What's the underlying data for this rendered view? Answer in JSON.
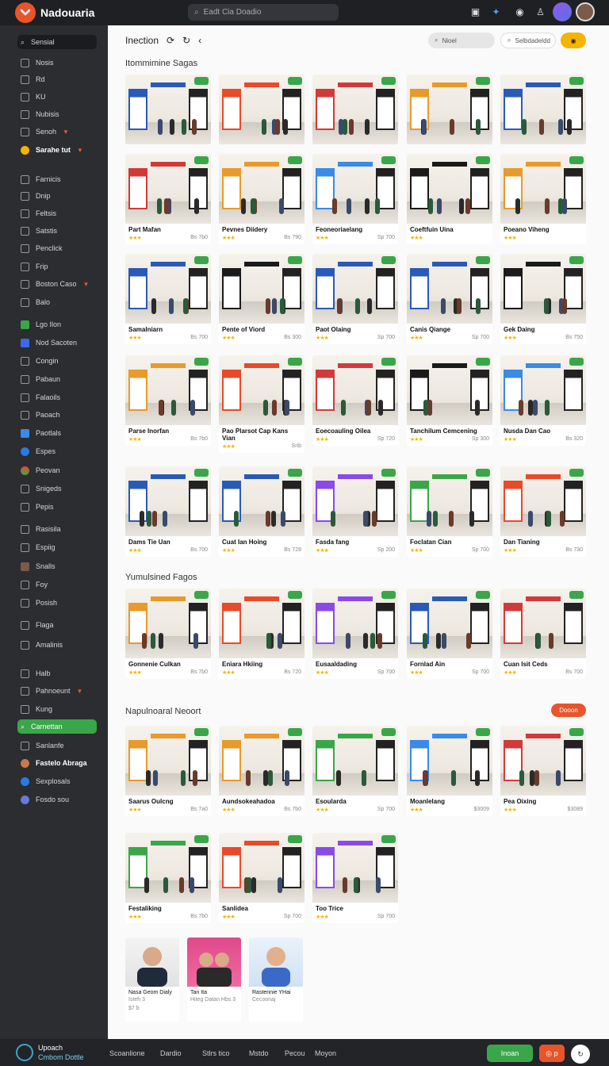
{
  "app": {
    "name": "Nadouaria",
    "search_placeholder": "Eadt Cia Doadio"
  },
  "sidebar": {
    "items": [
      {
        "label": "Sensial",
        "y": 0
      },
      {
        "label": "Nosis"
      },
      {
        "label": "Rd"
      },
      {
        "label": "KU"
      },
      {
        "label": "Nubisis"
      },
      {
        "label": "Senoh"
      },
      {
        "label": "Sarahe tut"
      },
      {
        "label": "Farnicis"
      },
      {
        "label": "Dnip"
      },
      {
        "label": "Feltsis"
      },
      {
        "label": "Satstis"
      },
      {
        "label": "Penclick"
      },
      {
        "label": "Frip"
      },
      {
        "label": "Boston Caso"
      },
      {
        "label": "Balo"
      },
      {
        "label": "Lgo Ilon"
      },
      {
        "label": "Nod Sacoten"
      },
      {
        "label": "Congin"
      },
      {
        "label": "Pabaun"
      },
      {
        "label": "Falaoils"
      },
      {
        "label": "Paoach"
      },
      {
        "label": "Paotlals"
      },
      {
        "label": "Espes"
      },
      {
        "label": "Peovan"
      },
      {
        "label": "Snigeds"
      },
      {
        "label": "Pepis"
      },
      {
        "label": "Rasisila"
      },
      {
        "label": "Espiig"
      },
      {
        "label": "Snalls"
      },
      {
        "label": "Foy"
      },
      {
        "label": "Posish"
      },
      {
        "label": "Flaga"
      },
      {
        "label": "Amalinis"
      },
      {
        "label": "Halb"
      },
      {
        "label": "Pahnoeunt"
      },
      {
        "label": "Kung"
      },
      {
        "label": "Carnettan"
      },
      {
        "label": "Sanlanfe"
      },
      {
        "label": "Fastelo Abraga"
      },
      {
        "label": "Sexplosals"
      },
      {
        "label": "Fosdo sou"
      }
    ]
  },
  "header": {
    "breadcrumb": "Inection",
    "search_pill": "Nioel",
    "filter_pill": "Selbdadeldd"
  },
  "sections": [
    {
      "title": "Itommimine Sagas"
    },
    {
      "title": "Yumulsined Fagos"
    },
    {
      "title": "Napulnoaral Neoort",
      "action": "Dooon"
    }
  ],
  "grid1": [
    [
      {
        "title": "",
        "meta": ""
      },
      {
        "title": "",
        "meta": ""
      },
      {
        "title": "",
        "meta": ""
      },
      {
        "title": "",
        "meta": ""
      },
      {
        "title": "",
        "meta": ""
      }
    ],
    [
      {
        "title": "Part Mafan",
        "meta": "Bs 7b0"
      },
      {
        "title": "Pevnes Diidery",
        "meta": "Bs 790"
      },
      {
        "title": "Feoneoriaelang",
        "meta": "Sp 700"
      },
      {
        "title": "Coeftfuin Uina",
        "meta": ""
      },
      {
        "title": "Poeano Viheng",
        "meta": ""
      }
    ],
    [
      {
        "title": "Samalniarn",
        "meta": "Bs 700"
      },
      {
        "title": "Pente of Viord",
        "meta": "Bs 300"
      },
      {
        "title": "Paot Olaing",
        "meta": "Sp 700"
      },
      {
        "title": "Canis Qiange",
        "meta": "Sp 700"
      },
      {
        "title": "Gek Daing",
        "meta": "Bs 750"
      }
    ],
    [
      {
        "title": "Parse Inorfan",
        "meta": "Bs 7b0"
      },
      {
        "title": "Pao Plarsot Cap Kans Vian",
        "meta": "Srib"
      },
      {
        "title": "Eoecoauling Oilea",
        "meta": "Sp 720"
      },
      {
        "title": "Tanchilum Cemcening",
        "meta": "Sp 300"
      },
      {
        "title": "Nusda Dan Cao",
        "meta": "Bs 320"
      }
    ],
    [
      {
        "title": "Dams Tie Uan",
        "meta": "Bs 700"
      },
      {
        "title": "Cuat Ian Hoing",
        "meta": "Bs 728"
      },
      {
        "title": "Fasda fang",
        "meta": "Sp 200"
      },
      {
        "title": "Foclatan Cian",
        "meta": "Sp 700"
      },
      {
        "title": "Dan Tianing",
        "meta": "Bs 730"
      }
    ]
  ],
  "grid2": [
    {
      "title": "Gonnenie Culkan",
      "meta": "Bs 7b0"
    },
    {
      "title": "Eniara Hkiing",
      "meta": "Bs 720"
    },
    {
      "title": "Eusaaldading",
      "meta": "Sp 700"
    },
    {
      "title": "Fornlad Ain",
      "meta": "Sp 700"
    },
    {
      "title": "Cuan Isit Ceds",
      "meta": "Bs 700"
    }
  ],
  "grid3": [
    {
      "title": "Saarus Oulcng",
      "meta": "Bs 7a0"
    },
    {
      "title": "Aundsokeahadoa",
      "meta": "Bs 7b0"
    },
    {
      "title": "Esoularda",
      "meta": "Sp 700"
    },
    {
      "title": "Moanlelang",
      "meta": "$3009"
    },
    {
      "title": "Pea Oixing",
      "meta": "$3089"
    },
    {
      "title": "Festaliking",
      "meta": "Bs 7b0"
    },
    {
      "title": "Sanlidea",
      "meta": "Sp 700"
    },
    {
      "title": "Too Trice",
      "meta": "Sp 700"
    }
  ],
  "people": [
    {
      "title": "Nasa Geom Dialy",
      "sub": "Isteh 3",
      "meta": "$7 b"
    },
    {
      "title": "Tan Ita",
      "sub": "Hiteg Datan Hbs 3",
      "meta": ""
    },
    {
      "title": "Rastennie YHai",
      "sub": "Cecoonaj",
      "meta": ""
    }
  ],
  "footer": {
    "brand1": "Upoach",
    "brand2": "Cmbom Dottle",
    "links": [
      "Scoanlione",
      "Dardio",
      "Stlrs tico",
      "Mstdo",
      "Pecou",
      "Moyon"
    ],
    "primary": "Inoan",
    "secondary": "p"
  }
}
